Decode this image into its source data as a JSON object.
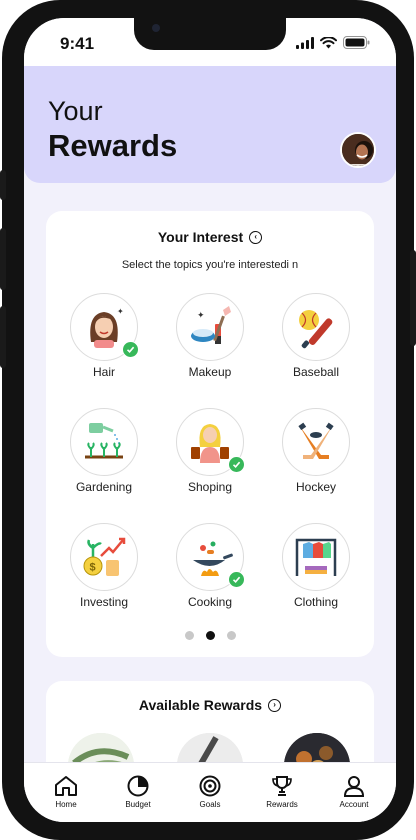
{
  "status": {
    "time": "9:41"
  },
  "header": {
    "line1": "Your",
    "line2": "Rewards"
  },
  "interest": {
    "title": "Your Interest",
    "subtitle": "Select the topics you're interestedi n",
    "topics": [
      {
        "label": "Hair",
        "icon": "hair-icon",
        "selected": true
      },
      {
        "label": "Makeup",
        "icon": "makeup-icon",
        "selected": false
      },
      {
        "label": "Baseball",
        "icon": "baseball-icon",
        "selected": false
      },
      {
        "label": "Gardening",
        "icon": "gardening-icon",
        "selected": false
      },
      {
        "label": "Shoping",
        "icon": "shopping-icon",
        "selected": true
      },
      {
        "label": "Hockey",
        "icon": "hockey-icon",
        "selected": false
      },
      {
        "label": "Investing",
        "icon": "investing-icon",
        "selected": false
      },
      {
        "label": "Cooking",
        "icon": "cooking-icon",
        "selected": true
      },
      {
        "label": "Clothing",
        "icon": "clothing-icon",
        "selected": false
      }
    ],
    "pagination": {
      "pages": 3,
      "active_index": 1
    }
  },
  "rewards": {
    "title": "Available Rewards"
  },
  "tabbar": {
    "items": [
      {
        "label": "Home",
        "icon": "home-icon"
      },
      {
        "label": "Budget",
        "icon": "pie-chart-icon"
      },
      {
        "label": "Goals",
        "icon": "target-icon"
      },
      {
        "label": "Rewards",
        "icon": "trophy-icon"
      },
      {
        "label": "Account",
        "icon": "user-icon"
      }
    ]
  },
  "colors": {
    "header_bg": "#d8d6fb",
    "screen_bg": "#f2f1fb",
    "check_green": "#37b85a",
    "phone_frame": "#121212"
  }
}
